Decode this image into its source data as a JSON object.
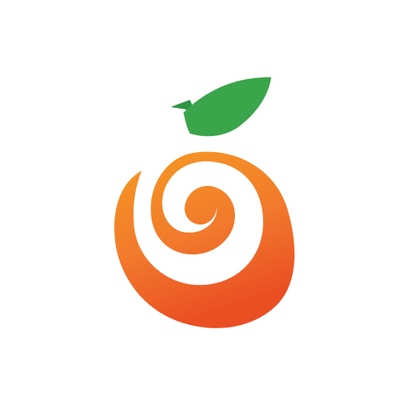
{
  "logo": {
    "icon": "orange-swirl-logo",
    "colors": {
      "background": "#ffffff",
      "orange_light": "#f59a22",
      "orange_mid": "#f27a2c",
      "orange_dark": "#ea4e23",
      "leaf": "#3ba54b",
      "stem": "#2f9344"
    }
  }
}
